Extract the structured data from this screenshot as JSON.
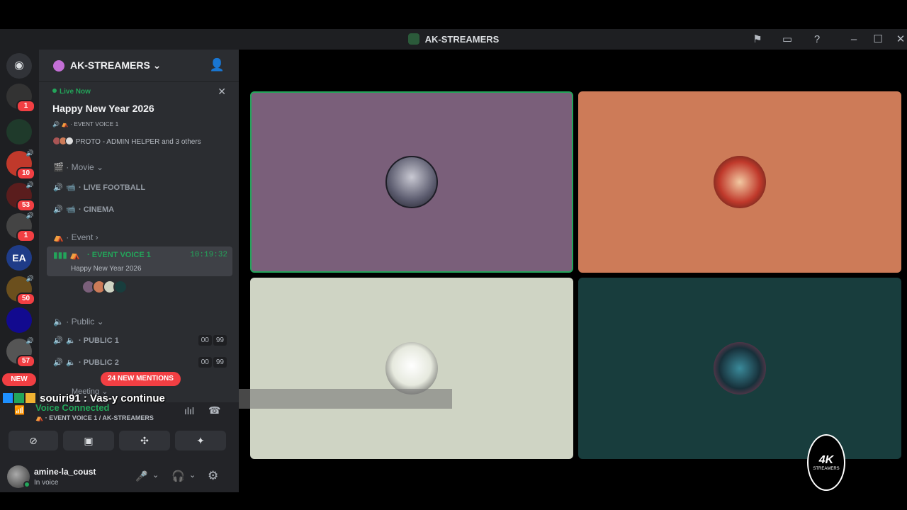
{
  "window": {
    "title": "AK-STREAMERS",
    "controls": {
      "minimize": "–",
      "maximize": "☐",
      "close": "✕"
    }
  },
  "server_rail": {
    "items": [
      {
        "name": "home",
        "color": "#5865f2"
      },
      {
        "name": "server-1",
        "badge": "1",
        "color": "#333"
      },
      {
        "name": "server-2",
        "badge": "",
        "color": "#1f3a2b"
      },
      {
        "name": "server-3",
        "badge": "10",
        "color": "#c0392b"
      },
      {
        "name": "server-4",
        "badge": "53",
        "color": "#5a1d1d"
      },
      {
        "name": "server-5",
        "badge": "1",
        "color": "#444"
      },
      {
        "name": "server-6",
        "badge": "",
        "color": "#1f3c88"
      },
      {
        "name": "server-7",
        "badge": "50",
        "color": "#6b4f1d"
      },
      {
        "name": "server-8",
        "badge": "",
        "color": "#120a8f"
      },
      {
        "name": "server-9",
        "badge": "57",
        "color": "#555"
      }
    ],
    "new_label": "NEW",
    "fa_label": "EA"
  },
  "server": {
    "name": "AK-STREAMERS",
    "chevron": "⌄"
  },
  "live_now": {
    "label": "Live Now",
    "event_title": "Happy New Year 2026",
    "channel": "EVENT VOICE 1",
    "participants": "PROTO - ADMIN HELPER and 3 others"
  },
  "categories": {
    "movie": "Movie",
    "event": "Event",
    "public": "Public",
    "meeting": "Meeting"
  },
  "channels": {
    "live_football": "LIVE FOOTBALL",
    "cinema": "CINEMA",
    "event_voice_1": "EVENT VOICE 1",
    "event_voice_1_time": "10:19:32",
    "event_voice_1_desc": "Happy New Year 2026",
    "public_1": "PUBLIC 1",
    "public_2": "PUBLIC 2",
    "count_a": "00",
    "count_b": "99"
  },
  "mentions_pill": "24 NEW MENTIONS",
  "voice_panel": {
    "status": "Voice Connected",
    "location": "EVENT VOICE 1 / AK-STREAMERS"
  },
  "user": {
    "name": "amine-la_coust",
    "status": "In voice"
  },
  "overlay": {
    "message": "souiri91 : Vas-y continue"
  },
  "stage": {
    "tiles": [
      {
        "name": "tile-1",
        "bg": "#7a5f7a",
        "speaking": true
      },
      {
        "name": "tile-2",
        "bg": "#cd7b58",
        "speaking": false
      },
      {
        "name": "tile-3",
        "bg": "#cfd4c4",
        "speaking": false
      },
      {
        "name": "tile-4",
        "bg": "#183d3d",
        "speaking": false
      }
    ]
  },
  "watermark": {
    "big": "4K",
    "small": "STREAMERS"
  },
  "colors": {
    "accent_green": "#23a55a",
    "danger_red": "#f23f43",
    "sidebar": "#2b2d31",
    "rail": "#1e1f22"
  }
}
